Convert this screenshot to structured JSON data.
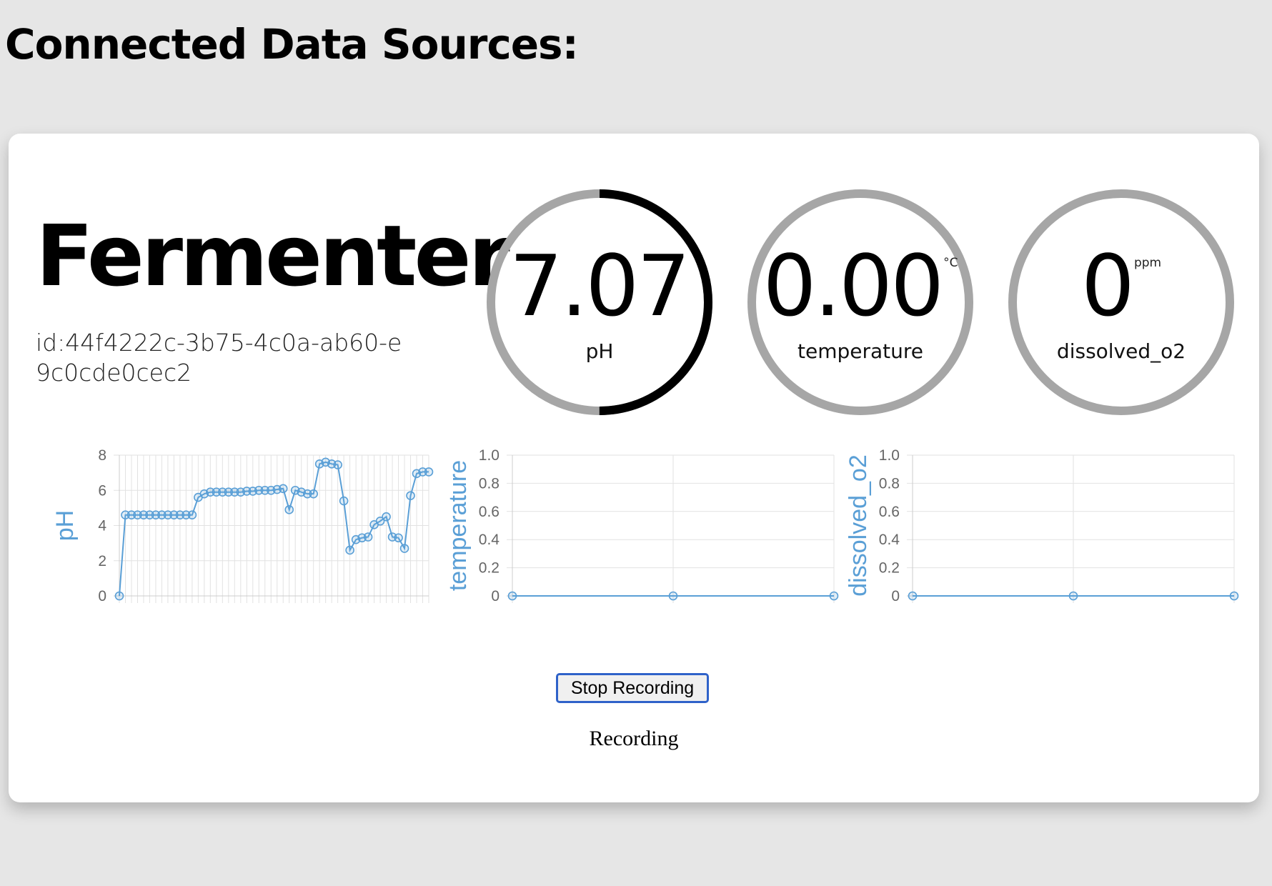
{
  "page": {
    "title": "Connected Data Sources:"
  },
  "device": {
    "name": "Fermenter",
    "id_text": "id:44f4222c-3b75-4c0a-ab60-e9c0cde0cec2"
  },
  "gauges": [
    {
      "value": "7.07",
      "unit": "",
      "label": "pH",
      "fill_fraction": 0.5
    },
    {
      "value": "0.00",
      "unit": "°C",
      "label": "temperature",
      "fill_fraction": 0
    },
    {
      "value": "0",
      "unit": "ppm",
      "label": "dissolved_o2",
      "fill_fraction": 0
    }
  ],
  "colors": {
    "gauge_track": "#a6a6a6",
    "gauge_fill": "#000000",
    "series_line": "#5a9fd6",
    "grid": "#e2e2e2",
    "button_border": "#2f62c9"
  },
  "controls": {
    "stop_button_label": "Stop Recording",
    "status": "Recording"
  },
  "chart_data": [
    {
      "type": "line",
      "ylabel": "pH",
      "xlabel": "",
      "ylim": [
        0,
        8
      ],
      "yticks": [
        "0",
        "2",
        "4",
        "6",
        "8"
      ],
      "grid": true,
      "series": [
        {
          "values": [
            0,
            4.6,
            4.6,
            4.6,
            4.6,
            4.6,
            4.6,
            4.6,
            4.6,
            4.6,
            4.6,
            4.6,
            4.6,
            5.6,
            5.8,
            5.9,
            5.9,
            5.9,
            5.9,
            5.9,
            5.9,
            5.95,
            5.95,
            6.0,
            6.0,
            6.0,
            6.05,
            6.1,
            4.9,
            6.0,
            5.9,
            5.8,
            5.8,
            7.5,
            7.6,
            7.5,
            7.45,
            5.4,
            2.6,
            3.2,
            3.3,
            3.35,
            4.05,
            4.25,
            4.5,
            3.35,
            3.3,
            2.7,
            5.7,
            6.95,
            7.05,
            7.05
          ]
        }
      ]
    },
    {
      "type": "line",
      "ylabel": "temperature",
      "xlabel": "",
      "ylim": [
        0,
        1.0
      ],
      "yticks": [
        "0",
        "0.2",
        "0.4",
        "0.6",
        "0.8",
        "1.0"
      ],
      "grid": true,
      "series": [
        {
          "values": [
            0,
            0,
            0
          ]
        }
      ]
    },
    {
      "type": "line",
      "ylabel": "dissolved_o2",
      "xlabel": "",
      "ylim": [
        0,
        1.0
      ],
      "yticks": [
        "0",
        "0.2",
        "0.4",
        "0.6",
        "0.8",
        "1.0"
      ],
      "grid": true,
      "series": [
        {
          "values": [
            0,
            0,
            0
          ]
        }
      ]
    }
  ]
}
